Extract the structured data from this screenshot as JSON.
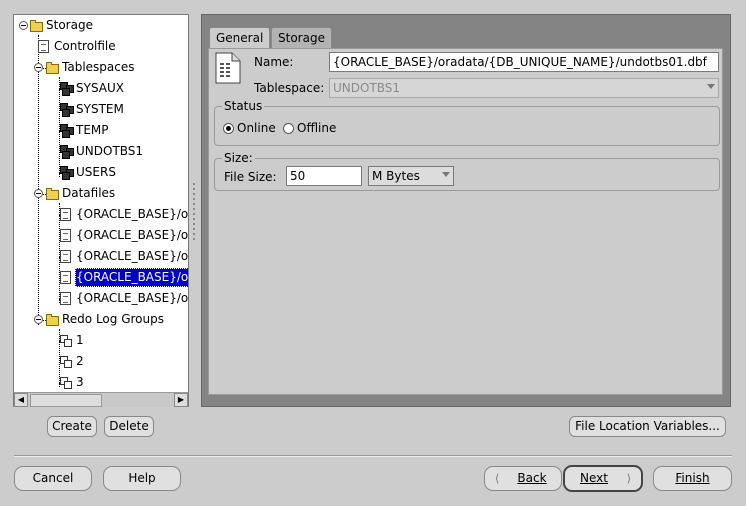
{
  "tree": {
    "items": [
      {
        "label": "Storage",
        "icon": "folder-icon",
        "level": 0,
        "expanded": true
      },
      {
        "label": "Controlfile",
        "icon": "document-icon",
        "level": 1
      },
      {
        "label": "Tablespaces",
        "icon": "folder-icon",
        "level": 1,
        "expanded": true
      },
      {
        "label": "SYSAUX",
        "icon": "tablespace-icon",
        "level": 2
      },
      {
        "label": "SYSTEM",
        "icon": "tablespace-icon",
        "level": 2
      },
      {
        "label": "TEMP",
        "icon": "tablespace-icon",
        "level": 2
      },
      {
        "label": "UNDOTBS1",
        "icon": "tablespace-icon",
        "level": 2
      },
      {
        "label": "USERS",
        "icon": "tablespace-icon",
        "level": 2
      },
      {
        "label": "Datafiles",
        "icon": "folder-icon",
        "level": 1,
        "expanded": true
      },
      {
        "label": "{ORACLE_BASE}/o",
        "icon": "datafile-icon",
        "level": 2
      },
      {
        "label": "{ORACLE_BASE}/o",
        "icon": "datafile-icon",
        "level": 2
      },
      {
        "label": "{ORACLE_BASE}/o",
        "icon": "datafile-icon",
        "level": 2
      },
      {
        "label": "{ORACLE_BASE}/o",
        "icon": "datafile-icon",
        "level": 2,
        "selected": true
      },
      {
        "label": "{ORACLE_BASE}/o",
        "icon": "datafile-icon",
        "level": 2
      },
      {
        "label": "Redo Log Groups",
        "icon": "folder-icon",
        "level": 1,
        "expanded": true
      },
      {
        "label": "1",
        "icon": "redo-group-icon",
        "level": 2
      },
      {
        "label": "2",
        "icon": "redo-group-icon",
        "level": 2
      },
      {
        "label": "3",
        "icon": "redo-group-icon",
        "level": 2
      }
    ]
  },
  "tabs": [
    {
      "label": "General",
      "active": true
    },
    {
      "label": "Storage",
      "active": false
    }
  ],
  "general": {
    "name_label": "Name:",
    "name_value": "{ORACLE_BASE}/oradata/{DB_UNIQUE_NAME}/undotbs01.dbf",
    "tablespace_label": "Tablespace:",
    "tablespace_value": "UNDOTBS1",
    "status": {
      "title": "Status",
      "online_label": "Online",
      "offline_label": "Offline",
      "selected": "Online"
    },
    "size": {
      "title": "Size:",
      "file_size_label": "File Size:",
      "file_size_value": "50",
      "unit_value": "M Bytes"
    }
  },
  "buttons": {
    "create": "Create",
    "delete": "Delete",
    "file_location_variables": "File Location Variables...",
    "cancel": "Cancel",
    "help": "Help",
    "back": "Back",
    "next": "Next",
    "finish": "Finish"
  },
  "colors": {
    "selection": "#0000cc",
    "panel_dark": "#848484",
    "background": "#cccccc"
  }
}
